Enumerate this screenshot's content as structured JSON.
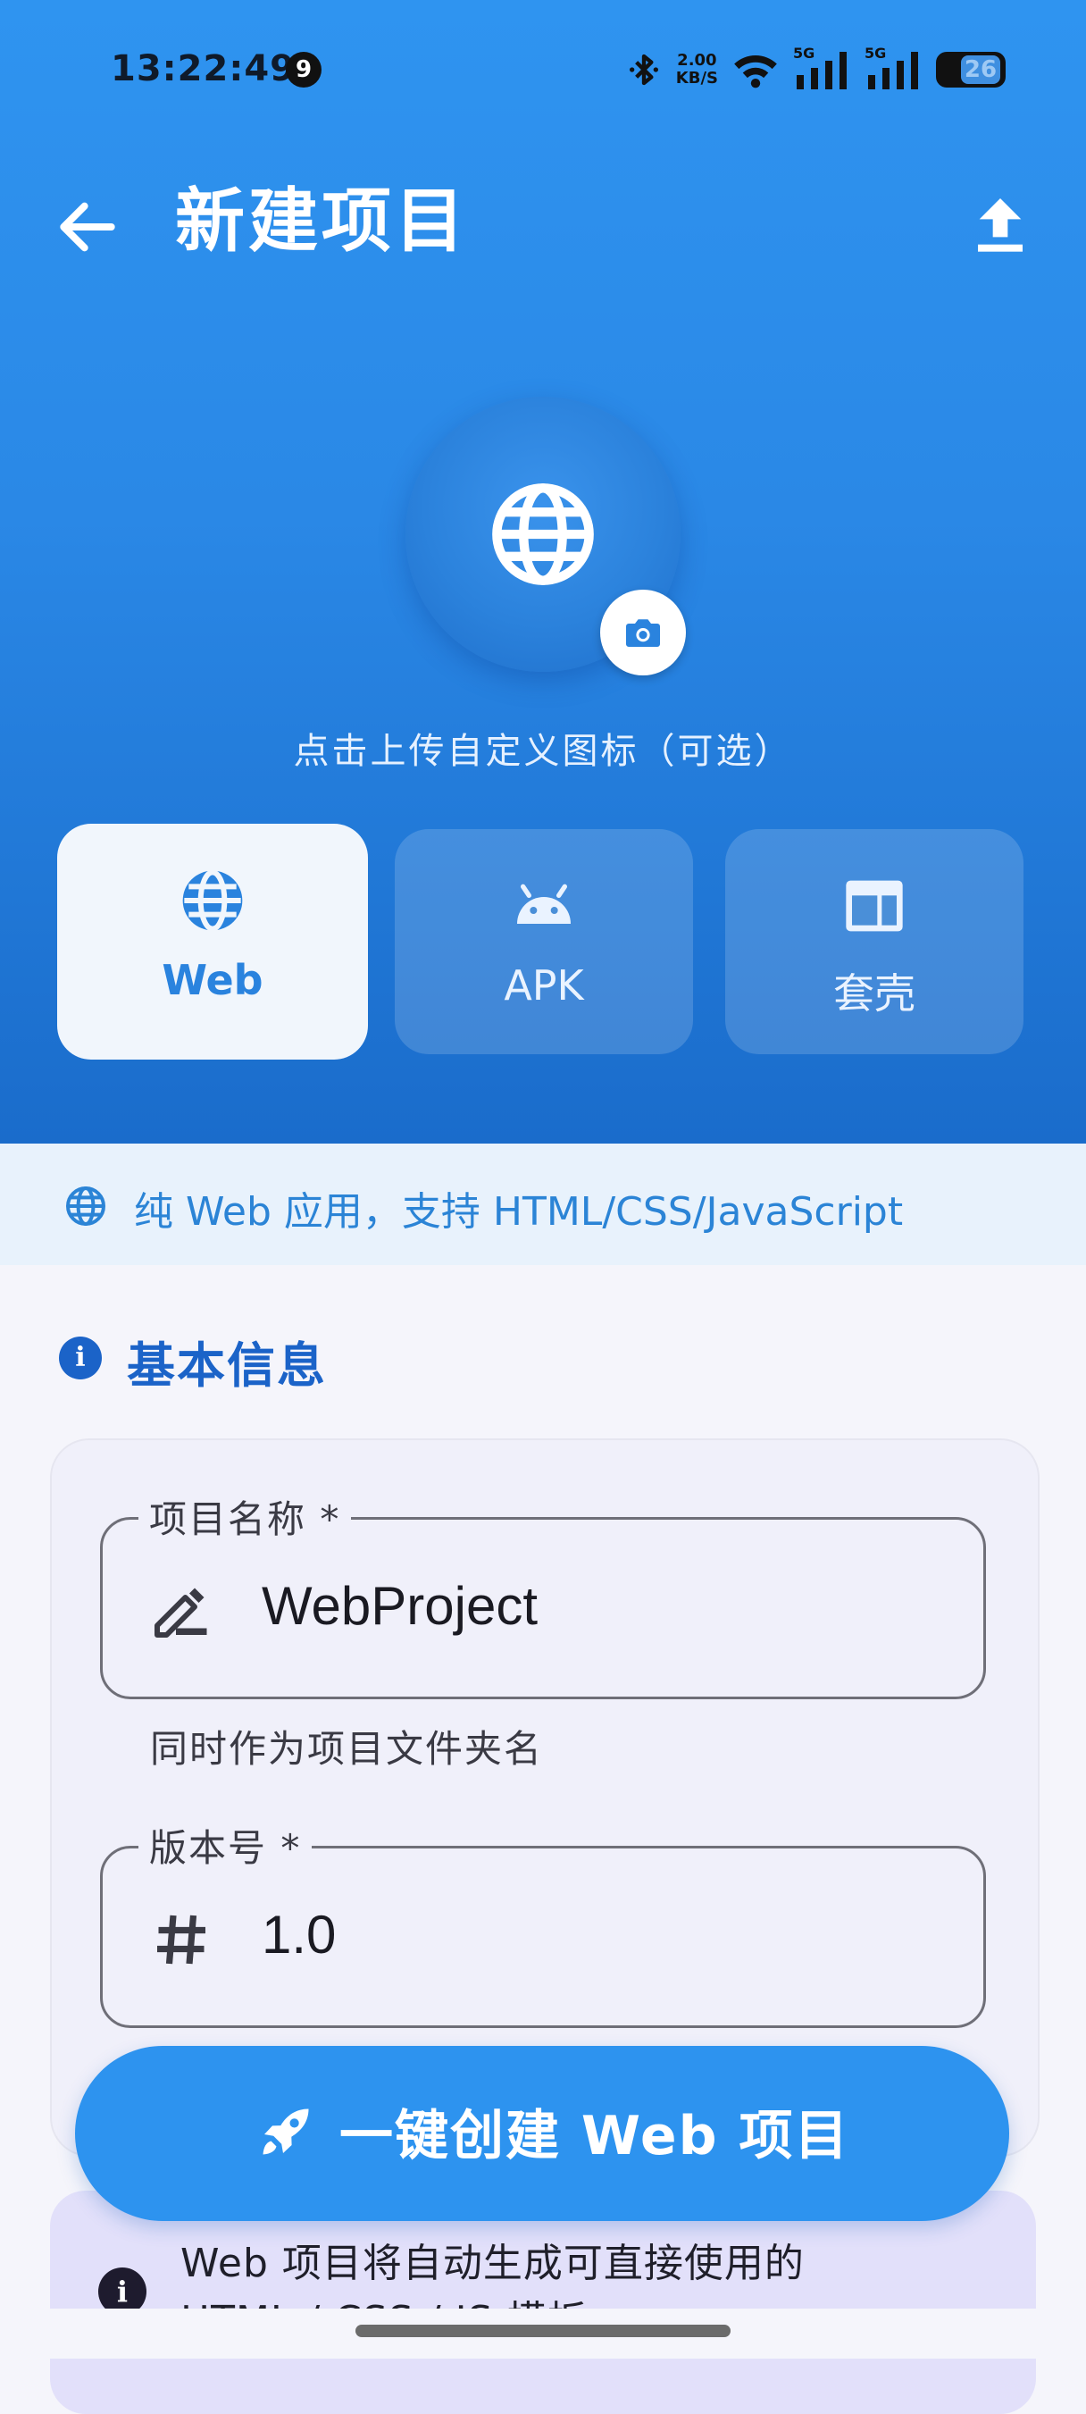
{
  "status_bar": {
    "time": "13:22:49",
    "notification_count": "9",
    "net_speed_value": "2.00",
    "net_speed_unit": "KB/S",
    "signal1_label": "5G",
    "signal2_label": "5G",
    "battery": "26"
  },
  "appbar": {
    "title": "新建项目",
    "back_icon": "arrow-left-icon",
    "upload_icon": "upload-icon"
  },
  "icon_picker": {
    "icon": "globe-icon",
    "camera_icon": "camera-icon",
    "hint": "点击上传自定义图标（可选）"
  },
  "type_tabs": [
    {
      "label": "Web",
      "icon": "globe-icon",
      "selected": true
    },
    {
      "label": "APK",
      "icon": "android-icon",
      "selected": false
    },
    {
      "label": "套壳",
      "icon": "web-layout-icon",
      "selected": false
    }
  ],
  "type_description": "纯 Web 应用，支持 HTML/CSS/JavaScript",
  "basic_info": {
    "section_title": "基本信息",
    "project_name": {
      "label": "项目名称 *",
      "value": "WebProject",
      "helper": "同时作为项目文件夹名",
      "icon": "edit-icon"
    },
    "version": {
      "label": "版本号 *",
      "value": "1.0",
      "icon": "hash-icon"
    }
  },
  "create_button": {
    "label": "一键创建 Web 项目",
    "icon": "rocket-icon"
  },
  "notice": {
    "line1": "Web 项目将自动生成可直接使用的",
    "line2": "HTML / CSS / JS 模板"
  },
  "colors": {
    "header_top": "#2f94f0",
    "header_bottom": "#1a6ccb",
    "accent": "#2d93ef",
    "section_title": "#1b63c8",
    "notice_bg": "#e2e0fa"
  }
}
